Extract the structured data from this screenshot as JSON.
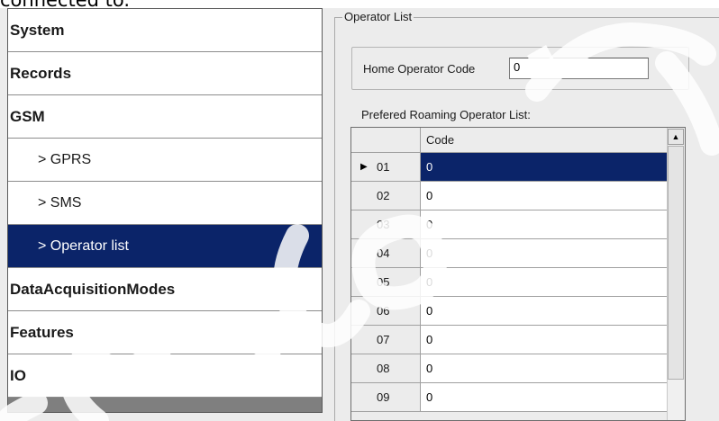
{
  "page": {
    "intro_fragment": "connected to."
  },
  "nav": {
    "items": [
      {
        "label": "System",
        "level": "top",
        "selected": false
      },
      {
        "label": "Records",
        "level": "top",
        "selected": false
      },
      {
        "label": "GSM",
        "level": "top",
        "selected": false
      },
      {
        "label": "> GPRS",
        "level": "sub",
        "selected": false
      },
      {
        "label": "> SMS",
        "level": "sub",
        "selected": false
      },
      {
        "label": "> Operator list",
        "level": "sub",
        "selected": true
      },
      {
        "label": "DataAcquisitionModes",
        "level": "top",
        "selected": false
      },
      {
        "label": "Features",
        "level": "top",
        "selected": false
      },
      {
        "label": "IO",
        "level": "top",
        "selected": false
      }
    ]
  },
  "operator_list": {
    "group_title": "Operator List",
    "home_operator_label": "Home Operator Code",
    "home_operator_value": "0",
    "roaming_label": "Prefered Roaming Operator List:",
    "grid": {
      "column_header": "Code",
      "current_row_marker": "▶",
      "rows": [
        {
          "index": "01",
          "code": "0",
          "selected": true
        },
        {
          "index": "02",
          "code": "0",
          "selected": false
        },
        {
          "index": "03",
          "code": "0",
          "selected": false
        },
        {
          "index": "04",
          "code": "0",
          "selected": false
        },
        {
          "index": "05",
          "code": "0",
          "selected": false
        },
        {
          "index": "06",
          "code": "0",
          "selected": false
        },
        {
          "index": "07",
          "code": "0",
          "selected": false
        },
        {
          "index": "08",
          "code": "0",
          "selected": false
        },
        {
          "index": "09",
          "code": "0",
          "selected": false
        }
      ]
    },
    "scroll_up_glyph": "▲"
  },
  "colors": {
    "selection": "#0b2469",
    "window_bg": "#ececec"
  }
}
